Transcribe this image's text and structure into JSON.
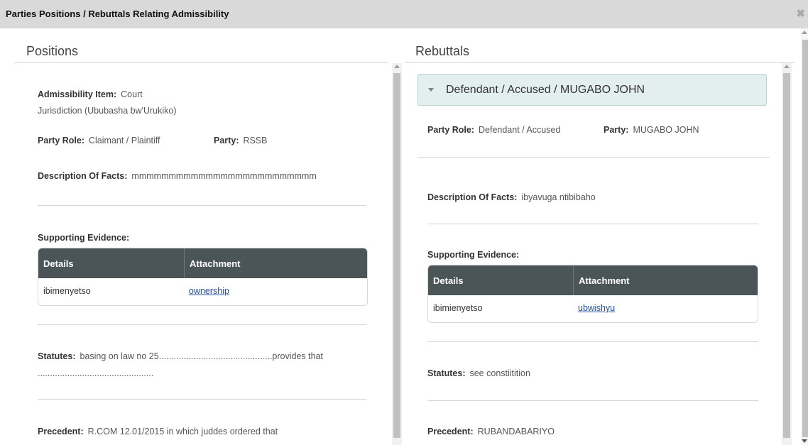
{
  "dialog": {
    "title": "Parties Positions / Rebuttals Relating Admissibility",
    "close_icon": "✖"
  },
  "positions": {
    "heading": "Positions",
    "admissibility_item_label": "Admissibility Item:",
    "admissibility_item_line1": "Court",
    "admissibility_item_line2": "Jurisdiction (Ububasha bw'Urukiko)",
    "party_role_label": "Party Role:",
    "party_role": "Claimant / Plaintiff",
    "party_label": "Party:",
    "party": "RSSB",
    "description_label": "Description Of Facts:",
    "description": "mmmmmmmmmmmmmmmmmmmmmmmmm",
    "supporting_evidence_label": "Supporting Evidence:",
    "evidence_headers": {
      "details": "Details",
      "attachment": "Attachment"
    },
    "evidence_row": {
      "details": "ibimenyetso",
      "attachment": "ownership"
    },
    "statutes_label": "Statutes:",
    "statutes_line1": "basing on law no 25..............................................provides that",
    "statutes_line2": "...............................................",
    "precedent_label": "Precedent:",
    "precedent": "R.COM 12.01/2015 in which juddes ordered that"
  },
  "rebuttals": {
    "heading": "Rebuttals",
    "accordion_title": "Defendant / Accused / MUGABO JOHN",
    "party_role_label": "Party Role:",
    "party_role": "Defendant / Accused",
    "party_label": "Party:",
    "party": "MUGABO JOHN",
    "description_label": "Description Of Facts:",
    "description": "ibyavuga ntibibaho",
    "supporting_evidence_label": "Supporting Evidence:",
    "evidence_headers": {
      "details": "Details",
      "attachment": "Attachment"
    },
    "evidence_row": {
      "details": "ibimienyetso",
      "attachment": "ubwishyu"
    },
    "statutes_label": "Statutes:",
    "statutes": "see constiitition",
    "precedent_label": "Precedent:",
    "precedent": "RUBANDABARIYO"
  }
}
